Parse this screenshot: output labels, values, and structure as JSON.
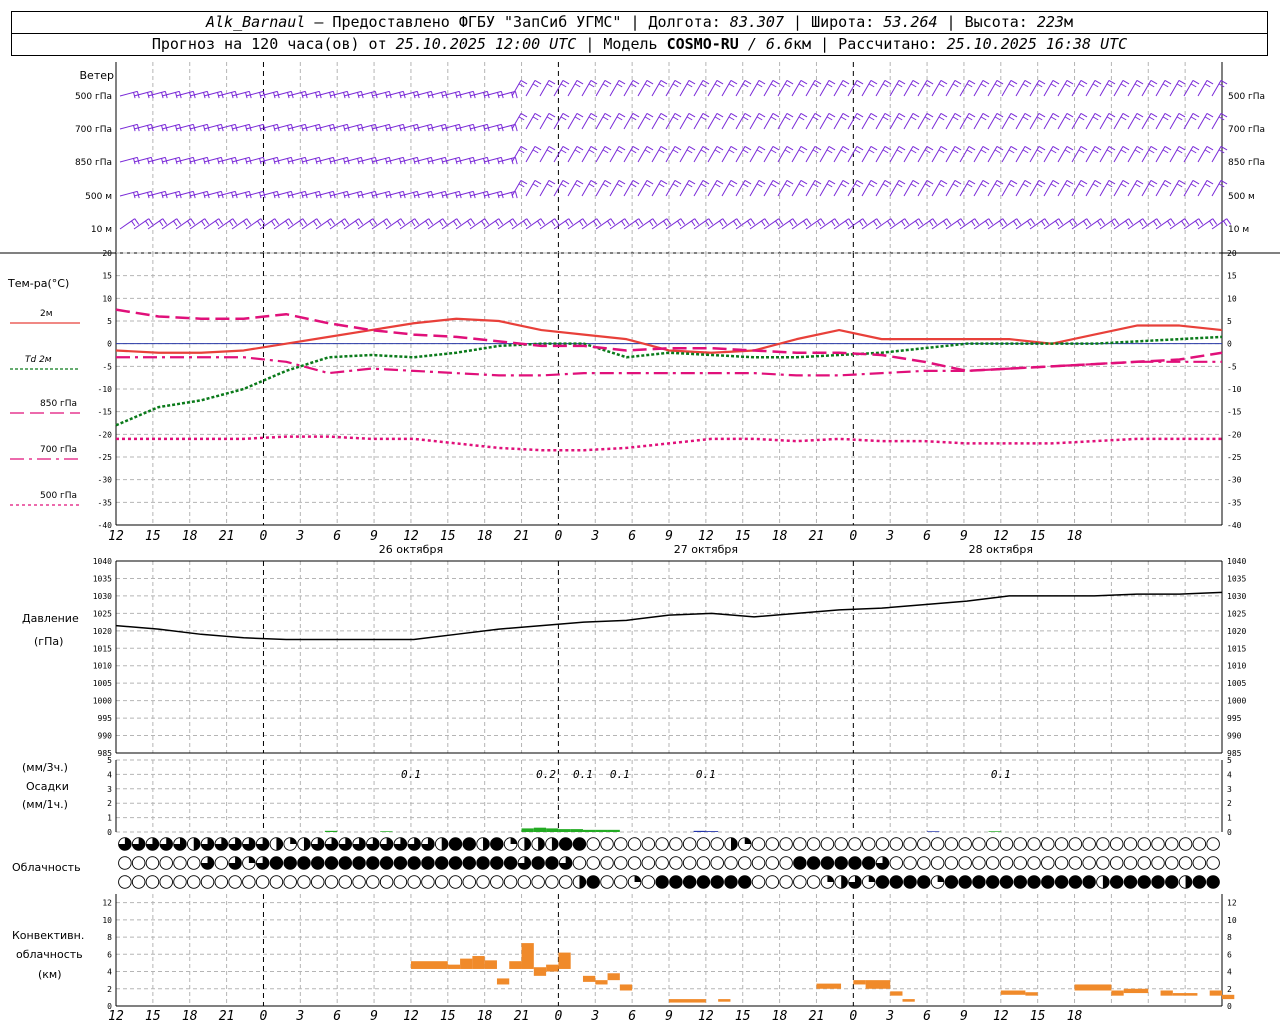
{
  "header": {
    "station": "Alk_Barnaul",
    "provider": "– Предоставлено ФГБУ \"ЗапСиб УГМС\" | Долгота:",
    "lon": "83.307",
    "lat_label": "| Широта:",
    "lat": "53.264",
    "alt_label": "| Высота:",
    "alt": "223",
    "alt_unit": "м",
    "forecast_label": "Прогноз на 120 часа(ов) от",
    "forecast_time": "25.10.2025 12:00 UTC",
    "model_label": "| Модель",
    "model": "COSMO-RU",
    "model_res": "/ 6.6",
    "model_res_unit": "км",
    "calc_label": "| Рассчитано:",
    "calc_time": "25.10.2025 16:38 UTC"
  },
  "colors": {
    "t2m": "#e8403a",
    "td2m": "#0a7a1a",
    "t850": "#e0107a",
    "t700": "#e0107a",
    "t500": "#e0107a",
    "pressure": "#000000",
    "precip_green": "#22aa22",
    "precip_blue": "#2233aa",
    "convective": "#f08a2a",
    "wind": "#7a2ad8"
  },
  "chart_data": [
    {
      "type": "wind-barbs",
      "title": "Ветер",
      "levels": [
        "500 гПа",
        "700 гПа",
        "850 гПа",
        "500 м",
        "10 м"
      ]
    },
    {
      "type": "line",
      "title": "Тем-ра(°С)",
      "ylim": [
        -40,
        20
      ],
      "yticks": [
        20,
        15,
        10,
        5,
        0,
        -5,
        -10,
        -15,
        -20,
        -25,
        -30,
        -35,
        -40
      ],
      "legend": [
        {
          "key": "t2m",
          "label": "2м"
        },
        {
          "key": "td2m",
          "label": "Td 2м"
        },
        {
          "key": "t850",
          "label": "850 гПа"
        },
        {
          "key": "t700",
          "label": "700 гПа"
        },
        {
          "key": "t500",
          "label": "500 гПа"
        }
      ],
      "x_hours": [
        0,
        3,
        6,
        9,
        12,
        15,
        18,
        21,
        24,
        27,
        30,
        33,
        36,
        39,
        42,
        45,
        48,
        51,
        54,
        57,
        60,
        63,
        66,
        69,
        72,
        75,
        78
      ],
      "series": [
        {
          "name": "2м",
          "key": "t2m",
          "values": [
            -1.5,
            -2,
            -2,
            -1.5,
            0,
            1.5,
            3,
            4.5,
            5.5,
            5,
            3,
            2,
            1,
            -1.5,
            -2,
            -1.5,
            1,
            3,
            1,
            1,
            1,
            1,
            0,
            2,
            4,
            4,
            3
          ]
        },
        {
          "name": "Td 2м",
          "key": "td2m",
          "values": [
            -18,
            -14,
            -12.5,
            -10,
            -6,
            -3,
            -2.5,
            -3,
            -2,
            -0.5,
            0,
            0,
            -3,
            -2,
            -2.5,
            -3,
            -3,
            -2.5,
            -2,
            -1,
            0,
            0,
            0,
            0,
            0.5,
            1,
            1.5
          ]
        },
        {
          "name": "850 гПа",
          "key": "t850",
          "values": [
            7.5,
            6,
            5.5,
            5.5,
            6.5,
            4.5,
            3,
            2,
            1.5,
            0.5,
            -0.5,
            -0.5,
            -1.5,
            -1,
            -1,
            -1.5,
            -2,
            -2,
            -2.5,
            -4,
            -6,
            -5.5,
            -5,
            -4.5,
            -4,
            -3.5,
            -2
          ]
        },
        {
          "name": "700 гПа",
          "key": "t700",
          "values": [
            -3,
            -3,
            -3,
            -3,
            -4,
            -6.5,
            -5.5,
            -6,
            -6.5,
            -7,
            -7,
            -6.5,
            -6.5,
            -6.5,
            -6.5,
            -6.5,
            -7,
            -7,
            -6.5,
            -6,
            -6,
            -5.5,
            -5,
            -4.5,
            -4,
            -4,
            -4
          ]
        },
        {
          "name": "500 гПа",
          "key": "t500",
          "values": [
            -21,
            -21,
            -21,
            -21,
            -20.5,
            -20.5,
            -21,
            -21,
            -22,
            -23,
            -23.5,
            -23.5,
            -23,
            -22,
            -21,
            -21,
            -21.5,
            -21,
            -21.5,
            -21.5,
            -22,
            -22,
            -22,
            -21.5,
            -21,
            -21,
            -21
          ]
        }
      ]
    },
    {
      "type": "line",
      "title": "Давление",
      "unit": "(гПа)",
      "ylim": [
        985,
        1040
      ],
      "yticks": [
        1040,
        1035,
        1030,
        1025,
        1020,
        1015,
        1010,
        1005,
        1000,
        995,
        990,
        985
      ],
      "x_hours": [
        0,
        3,
        6,
        9,
        12,
        15,
        18,
        21,
        24,
        27,
        30,
        33,
        36,
        39,
        42,
        45,
        48,
        51,
        54,
        57,
        60,
        63,
        66,
        69,
        72,
        75,
        78
      ],
      "series": [
        {
          "name": "Давление",
          "key": "pressure",
          "values": [
            1021.5,
            1020.5,
            1019,
            1018,
            1017.5,
            1017.5,
            1017.5,
            1017.5,
            1019,
            1020.5,
            1021.5,
            1022.5,
            1023,
            1024.5,
            1025,
            1024,
            1025,
            1026,
            1026.5,
            1027.5,
            1028.5,
            1030,
            1030,
            1030,
            1030.5,
            1030.5,
            1031
          ]
        }
      ]
    },
    {
      "type": "bar",
      "title": "Осадки",
      "ylabel_top": "(мм/3ч.)",
      "ylabel_bottom": "(мм/1ч.)",
      "ylim": [
        0,
        5
      ],
      "yticks": [
        5,
        4,
        3,
        2,
        1,
        0
      ],
      "labels": [
        {
          "hour": 24,
          "text": "0.1"
        },
        {
          "hour": 35,
          "text": "0.2"
        },
        {
          "hour": 38,
          "text": "0.1"
        },
        {
          "hour": 41,
          "text": "0.1"
        },
        {
          "hour": 48,
          "text": "0.1"
        },
        {
          "hour": 72,
          "text": "0.1"
        }
      ],
      "bars": [
        {
          "hour": 17.5,
          "value": 0.08,
          "color": "precip_green"
        },
        {
          "hour": 22,
          "value": 0.05,
          "color": "precip_green"
        },
        {
          "hour": 33.5,
          "value": 0.25,
          "color": "precip_green"
        },
        {
          "hour": 34.5,
          "value": 0.3,
          "color": "precip_green"
        },
        {
          "hour": 35.5,
          "value": 0.25,
          "color": "precip_green"
        },
        {
          "hour": 36.5,
          "value": 0.2,
          "color": "precip_green"
        },
        {
          "hour": 37.5,
          "value": 0.2,
          "color": "precip_green"
        },
        {
          "hour": 38.5,
          "value": 0.15,
          "color": "precip_green"
        },
        {
          "hour": 39.5,
          "value": 0.15,
          "color": "precip_green"
        },
        {
          "hour": 40.5,
          "value": 0.15,
          "color": "precip_green"
        },
        {
          "hour": 47.5,
          "value": 0.08,
          "color": "precip_blue"
        },
        {
          "hour": 48.5,
          "value": 0.06,
          "color": "precip_blue"
        },
        {
          "hour": 66.5,
          "value": 0.05,
          "color": "precip_blue"
        },
        {
          "hour": 71.5,
          "value": 0.05,
          "color": "precip_green"
        }
      ]
    },
    {
      "type": "cloud-symbols",
      "title": "Облачность",
      "rows": [
        "0,0,0,0,0,0,0,0,0,0,0,0,0,0,0,0,0,0,0,0,0,0,0,0,0,0,0,0,0,0,0,0,0,0,0,0,0,0,0,0,0,0,0,0,0,0,0,0,0,0,0,0,0,0,0,0,0,0,0,0,0,0,0,0,0,0,0,0,0,0,0,0,0,0,0,0,0,0,0,0",
        "0,0,0,0,0,0,0,0,0,0,0,0,0,0,0,0,0,0,0,0,0,0,0,0,0,0,0,0,0,0,0,0,0,0,0,0,0,0,0,0,0,0,0,0,0,0,0,0,0,0,0,0,0,0,0,0,0,0,0,0,0,0,0,0,0,0,0,0,0,0,0,0,0,0,0,0,0,0,0,0",
        "0,0,0,0,0,0,0,0,0,0,0,0,0,0,0,0,0,0,0,0,0,0,0,0,0,0,0,0,0,0,0,0,0,0,0,0,0,0,0,0,0,0,0,0,0,0,0,0,0,0,0,0,0,0,0,0,0,0,0,0,0,0,0,0,0,0,0,0,0,0,0,0,0,0,0,0,0,0,0,0"
      ],
      "cloud_cover_top": [
        3,
        3,
        3,
        3,
        3,
        2,
        3,
        3,
        3,
        3,
        3,
        2,
        1,
        2,
        3,
        3,
        3,
        3,
        3,
        3,
        3,
        3,
        3,
        2,
        4,
        4,
        2,
        4,
        1,
        2,
        2,
        2,
        4,
        4,
        0,
        0,
        0,
        0,
        0,
        0,
        0,
        0,
        0,
        0,
        2,
        1,
        0,
        0,
        0,
        0,
        0,
        0,
        0,
        0,
        0,
        0,
        0,
        0,
        0,
        0,
        0,
        0,
        0,
        0,
        0,
        0,
        0,
        0,
        0,
        0,
        0,
        0,
        0,
        0,
        0,
        0,
        0,
        0,
        0,
        0
      ],
      "cloud_cover_mid": [
        0,
        0,
        0,
        0,
        0,
        0,
        3,
        0,
        3,
        1,
        3,
        4,
        4,
        4,
        4,
        4,
        4,
        4,
        4,
        4,
        4,
        4,
        4,
        4,
        4,
        4,
        4,
        4,
        4,
        3,
        4,
        4,
        3,
        0,
        0,
        0,
        0,
        0,
        0,
        0,
        0,
        0,
        0,
        0,
        0,
        0,
        0,
        0,
        0,
        4,
        4,
        4,
        4,
        4,
        4,
        3,
        0,
        0,
        0,
        0,
        0,
        0,
        0,
        0,
        0,
        0,
        0,
        0,
        0,
        0,
        0,
        0,
        0,
        0,
        0,
        0,
        0,
        0,
        0,
        0
      ],
      "cloud_cover_low": [
        0,
        0,
        0,
        0,
        0,
        0,
        0,
        0,
        0,
        0,
        0,
        0,
        0,
        0,
        0,
        0,
        0,
        0,
        0,
        0,
        0,
        0,
        0,
        0,
        0,
        0,
        0,
        0,
        0,
        0,
        0,
        0,
        0,
        2,
        4,
        0,
        0,
        1,
        0,
        4,
        4,
        4,
        4,
        4,
        4,
        4,
        0,
        0,
        0,
        0,
        0,
        1,
        2,
        3,
        1,
        4,
        4,
        4,
        4,
        1,
        4,
        4,
        4,
        4,
        4,
        4,
        4,
        4,
        4,
        4,
        4,
        2,
        4,
        4,
        4,
        4,
        4,
        2,
        4,
        4
      ]
    },
    {
      "type": "bar",
      "title": "Конвективн.",
      "title2": "облачность",
      "unit": "(км)",
      "ylim": [
        0,
        13
      ],
      "yticks": [
        12,
        10,
        8,
        6,
        4,
        2,
        0
      ],
      "segments": [
        {
          "h0": 24,
          "h1": 27,
          "bottom": 4.3,
          "top": 5.2
        },
        {
          "h0": 27,
          "h1": 28,
          "bottom": 4.3,
          "top": 4.8
        },
        {
          "h0": 28,
          "h1": 29,
          "bottom": 4.3,
          "top": 5.5
        },
        {
          "h0": 29,
          "h1": 30,
          "bottom": 4.3,
          "top": 5.8
        },
        {
          "h0": 30,
          "h1": 31,
          "bottom": 4.3,
          "top": 5.3
        },
        {
          "h0": 31,
          "h1": 32,
          "bottom": 2.5,
          "top": 3.2
        },
        {
          "h0": 32,
          "h1": 33,
          "bottom": 4.3,
          "top": 5.2
        },
        {
          "h0": 33,
          "h1": 34,
          "bottom": 4.3,
          "top": 7.3
        },
        {
          "h0": 34,
          "h1": 35,
          "bottom": 3.5,
          "top": 4.5
        },
        {
          "h0": 35,
          "h1": 36,
          "bottom": 4.0,
          "top": 4.8
        },
        {
          "h0": 36,
          "h1": 37,
          "bottom": 4.3,
          "top": 6.2
        },
        {
          "h0": 38,
          "h1": 39,
          "bottom": 2.8,
          "top": 3.5
        },
        {
          "h0": 39,
          "h1": 40,
          "bottom": 2.5,
          "top": 3.0
        },
        {
          "h0": 40,
          "h1": 41,
          "bottom": 3.0,
          "top": 3.8
        },
        {
          "h0": 41,
          "h1": 42,
          "bottom": 1.8,
          "top": 2.5
        },
        {
          "h0": 45,
          "h1": 48,
          "bottom": 0.4,
          "top": 0.8
        },
        {
          "h0": 49,
          "h1": 50,
          "bottom": 0.5,
          "top": 0.8
        },
        {
          "h0": 57,
          "h1": 59,
          "bottom": 2.0,
          "top": 2.6
        },
        {
          "h0": 60,
          "h1": 61,
          "bottom": 2.5,
          "top": 3.0
        },
        {
          "h0": 61,
          "h1": 63,
          "bottom": 2.0,
          "top": 3.0
        },
        {
          "h0": 63,
          "h1": 64,
          "bottom": 1.2,
          "top": 1.7
        },
        {
          "h0": 64,
          "h1": 65,
          "bottom": 0.5,
          "top": 0.8
        },
        {
          "h0": 72,
          "h1": 74,
          "bottom": 1.3,
          "top": 1.8
        },
        {
          "h0": 74,
          "h1": 75,
          "bottom": 1.2,
          "top": 1.6
        },
        {
          "h0": 78,
          "h1": 81,
          "bottom": 1.8,
          "top": 2.5
        },
        {
          "h0": 81,
          "h1": 82,
          "bottom": 1.2,
          "top": 1.8
        },
        {
          "h0": 82,
          "h1": 84,
          "bottom": 1.5,
          "top": 2.0
        },
        {
          "h0": 85,
          "h1": 86,
          "bottom": 1.2,
          "top": 1.8
        },
        {
          "h0": 86,
          "h1": 88,
          "bottom": 1.2,
          "top": 1.5
        },
        {
          "h0": 89,
          "h1": 90,
          "bottom": 1.2,
          "top": 1.8
        },
        {
          "h0": 90,
          "h1": 91,
          "bottom": 0.8,
          "top": 1.3
        }
      ]
    }
  ],
  "time_axis": {
    "tick_labels": [
      "12",
      "15",
      "18",
      "21",
      "0",
      "3",
      "6",
      "9",
      "12",
      "15",
      "18",
      "21",
      "0",
      "3",
      "6",
      "9",
      "12",
      "15",
      "18",
      "21",
      "0",
      "3",
      "6",
      "9",
      "12",
      "15",
      "18"
    ],
    "days": [
      {
        "hour": 24,
        "label": "26 октября"
      },
      {
        "hour": 48,
        "label": "27 октября"
      },
      {
        "hour": 72,
        "label": "28 октября"
      }
    ],
    "midnights": [
      12,
      36,
      60
    ]
  }
}
